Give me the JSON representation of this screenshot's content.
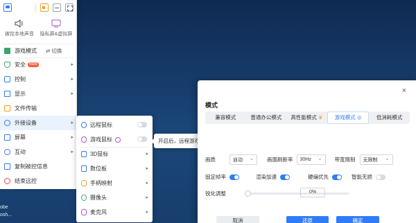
{
  "desktop": {
    "labels": [
      "obe",
      "osh..."
    ]
  },
  "top_buttons": [
    "app-icon",
    "speaker-icon",
    "minimize-icon",
    "fullscreen-icon"
  ],
  "quick_actions": [
    {
      "label": "被控本地声音",
      "icon": "speaker-icon"
    },
    {
      "label": "隐私屏&虚拟屏",
      "icon": "privacy-screen-icon"
    }
  ],
  "menu": {
    "game_mode": {
      "label": "游戏模式",
      "switch_label": "切换"
    },
    "items": [
      {
        "label": "安全",
        "badge": "NEW"
      },
      {
        "label": "控制"
      },
      {
        "label": "显示"
      },
      {
        "label": "文件传输"
      },
      {
        "label": "外接设备"
      },
      {
        "label": "屏幕"
      },
      {
        "label": "互动"
      },
      {
        "label": "复制被控信息"
      },
      {
        "label": "结束远控"
      }
    ]
  },
  "submenu": {
    "items": [
      {
        "label": "远程鼠标",
        "toggle": false
      },
      {
        "label": "游戏鼠标",
        "toggle": false
      },
      {
        "label": "3D鼠标"
      },
      {
        "label": "数位板"
      },
      {
        "label": "手柄映射"
      },
      {
        "label": "摄像头"
      },
      {
        "label": "麦克风"
      }
    ]
  },
  "tooltip": {
    "text": "开启后，远程游戏时鼠标可不受系统限制"
  },
  "dialog": {
    "close": "×",
    "title": "模式",
    "tabs": [
      "兼容模式",
      "普通办公模式",
      "高性能模式",
      "游戏模式",
      "低消耗模式"
    ],
    "active_tab": 3,
    "quality": {
      "label": "画质",
      "value": "自动"
    },
    "refresh": {
      "label": "画面刷新率",
      "value": "30Hz"
    },
    "bandwidth": {
      "label": "带宽限制",
      "value": "无限制"
    },
    "toggles": [
      {
        "label": "固定帧率",
        "on": true
      },
      {
        "label": "渲染加速",
        "on": true
      },
      {
        "label": "硬编优先",
        "on": true
      },
      {
        "label": "智能无损",
        "on": false
      }
    ],
    "sharpen": {
      "label": "锐化调整",
      "value": "0%",
      "level": 0
    },
    "buttons": {
      "cancel": "取消",
      "restore": "还原",
      "ok": "确定"
    }
  },
  "colors": {
    "accent": "#2f7cf6",
    "badge": "#ff5b3a",
    "desktop": "#163a66"
  }
}
